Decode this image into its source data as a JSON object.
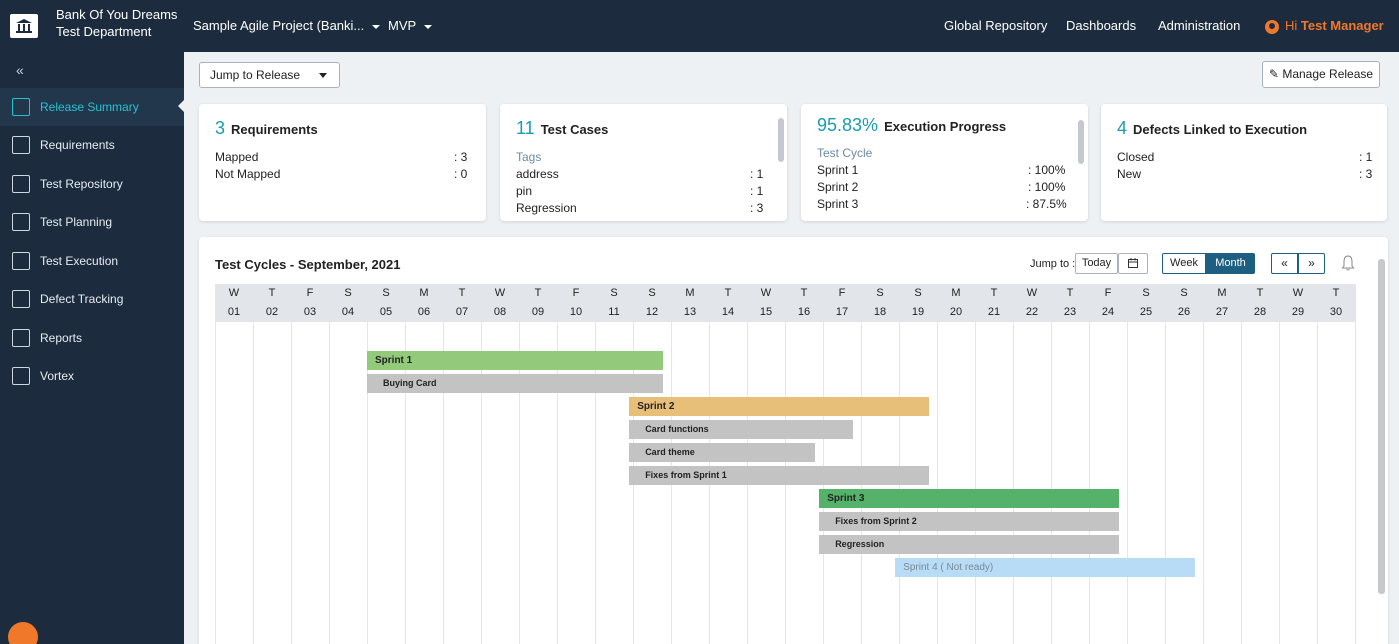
{
  "brand": {
    "name": "Bank Of You Dreams",
    "department": "Test Department"
  },
  "topbar": {
    "project": "Sample Agile Project (Banki...",
    "release": "MVP",
    "menus": [
      "Global Repository",
      "Dashboards",
      "Administration"
    ],
    "greeting": "Hi",
    "user": "Test Manager"
  },
  "sidebar": {
    "collapse": "«",
    "items": [
      {
        "label": "Release Summary",
        "icon": "release-summary-icon",
        "active": true
      },
      {
        "label": "Requirements",
        "icon": "requirements-icon"
      },
      {
        "label": "Test Repository",
        "icon": "test-repository-icon"
      },
      {
        "label": "Test Planning",
        "icon": "test-planning-icon"
      },
      {
        "label": "Test Execution",
        "icon": "test-execution-icon"
      },
      {
        "label": "Defect Tracking",
        "icon": "defect-tracking-icon"
      },
      {
        "label": "Reports",
        "icon": "reports-icon"
      },
      {
        "label": "Vortex",
        "icon": "vortex-icon"
      }
    ]
  },
  "toolbar": {
    "jump_to_release": "Jump to Release",
    "manage_release": "Manage Release"
  },
  "cards": {
    "requirements": {
      "count": "3",
      "title": "Requirements",
      "rows": [
        {
          "label": "Mapped",
          "value": ": 3"
        },
        {
          "label": "Not Mapped",
          "value": ": 0"
        }
      ]
    },
    "test_cases": {
      "count": "11",
      "title": "Test Cases",
      "sub": "Tags",
      "rows": [
        {
          "label": "address",
          "value": ": 1"
        },
        {
          "label": "pin",
          "value": ": 1"
        },
        {
          "label": "Regression",
          "value": ": 3"
        }
      ]
    },
    "execution": {
      "count": "95.83%",
      "title": "Execution Progress",
      "sub": "Test Cycle",
      "rows": [
        {
          "label": "Sprint 1",
          "value": ": 100%"
        },
        {
          "label": "Sprint 2",
          "value": ": 100%"
        },
        {
          "label": "Sprint 3",
          "value": ": 87.5%"
        }
      ]
    },
    "defects": {
      "count": "4",
      "title": "Defects Linked to Execution",
      "rows": [
        {
          "label": "Closed",
          "value": ": 1"
        },
        {
          "label": "New",
          "value": ": 3"
        }
      ]
    }
  },
  "cycles": {
    "title": "Test Cycles - September, 2021",
    "jump_to": "Jump to :",
    "today": "Today",
    "week": "Week",
    "month": "Month",
    "prev": "«",
    "next": "»",
    "weekdays": [
      "W",
      "T",
      "F",
      "S",
      "S",
      "M",
      "T",
      "W",
      "T",
      "F",
      "S",
      "S",
      "M",
      "T",
      "W",
      "T",
      "F",
      "S",
      "S",
      "M",
      "T",
      "W",
      "T",
      "F",
      "S",
      "S",
      "M",
      "T",
      "W",
      "T"
    ],
    "days": [
      "01",
      "02",
      "03",
      "04",
      "05",
      "06",
      "07",
      "08",
      "09",
      "10",
      "11",
      "12",
      "13",
      "14",
      "15",
      "16",
      "17",
      "18",
      "19",
      "20",
      "21",
      "22",
      "23",
      "24",
      "25",
      "26",
      "27",
      "28",
      "29",
      "30"
    ],
    "bars": [
      {
        "label": "Sprint 1",
        "start": 5,
        "end": 12.8,
        "kind": "sprint",
        "color": "#93c97a"
      },
      {
        "label": "Buying Card",
        "start": 5,
        "end": 12.8,
        "kind": "task"
      },
      {
        "label": "Sprint 2",
        "start": 11.9,
        "end": 19.8,
        "kind": "sprint",
        "color": "#e8bf78"
      },
      {
        "label": "Card functions",
        "start": 11.9,
        "end": 17.8,
        "kind": "task"
      },
      {
        "label": "Card theme",
        "start": 11.9,
        "end": 16.8,
        "kind": "task"
      },
      {
        "label": "Fixes from Sprint 1",
        "start": 11.9,
        "end": 19.8,
        "kind": "task"
      },
      {
        "label": "Sprint 3",
        "start": 16.9,
        "end": 24.8,
        "kind": "sprint",
        "color": "#54b26a"
      },
      {
        "label": "Fixes from Sprint 2",
        "start": 16.9,
        "end": 24.8,
        "kind": "task"
      },
      {
        "label": "Regression",
        "start": 16.9,
        "end": 24.8,
        "kind": "task"
      },
      {
        "label": "Sprint 4 ( Not ready)",
        "start": 18.9,
        "end": 26.8,
        "kind": "pending",
        "color": "#b8dcf5"
      }
    ]
  }
}
